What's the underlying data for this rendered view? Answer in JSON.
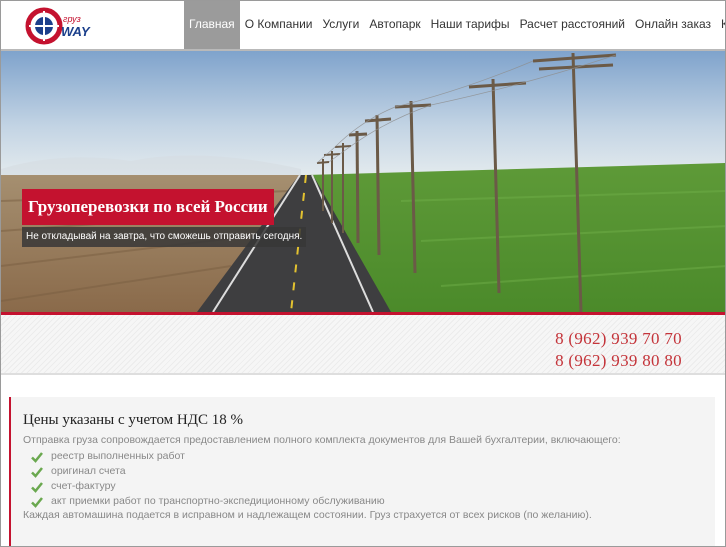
{
  "logo": {
    "top_text": "груз",
    "bottom_text": "WAY"
  },
  "nav": {
    "items": [
      {
        "label": "Главная",
        "active": true
      },
      {
        "label": "О Компании"
      },
      {
        "label": "Услуги"
      },
      {
        "label": "Автопарк"
      },
      {
        "label": "Наши тарифы"
      },
      {
        "label": "Расчет расстояний"
      },
      {
        "label": "Онлайн заказ"
      },
      {
        "label": "Контакты"
      }
    ]
  },
  "hero": {
    "title": "Грузоперевозки по всей России",
    "subtitle": "Не откладывай на завтра, что сможешь отправить сегодня."
  },
  "phones": [
    "8 (962) 939 70 70",
    "8 (962) 939 80 80"
  ],
  "content": {
    "heading": "Цены указаны с учетом НДС 18 %",
    "intro": "Отправка груза сопровождается предоставлением полного комплекта документов для Вашей бухгалтерии, включающего:",
    "documents": [
      "реестр выполненных работ",
      "оригинал счета",
      "счет-фактуру",
      "акт приемки работ по транспортно-экспедиционному обслуживанию"
    ],
    "outro": "Каждая автомашина подается в исправном и надлежащем состоянии. Груз страхуется от всех рисков (по желанию)."
  },
  "colors": {
    "accent": "#c4122f",
    "nav_active": "#9b9b9b",
    "check": "#6aa84f"
  },
  "icons": {
    "check": "checkmark-icon",
    "arrow": "triangle-down-icon"
  }
}
